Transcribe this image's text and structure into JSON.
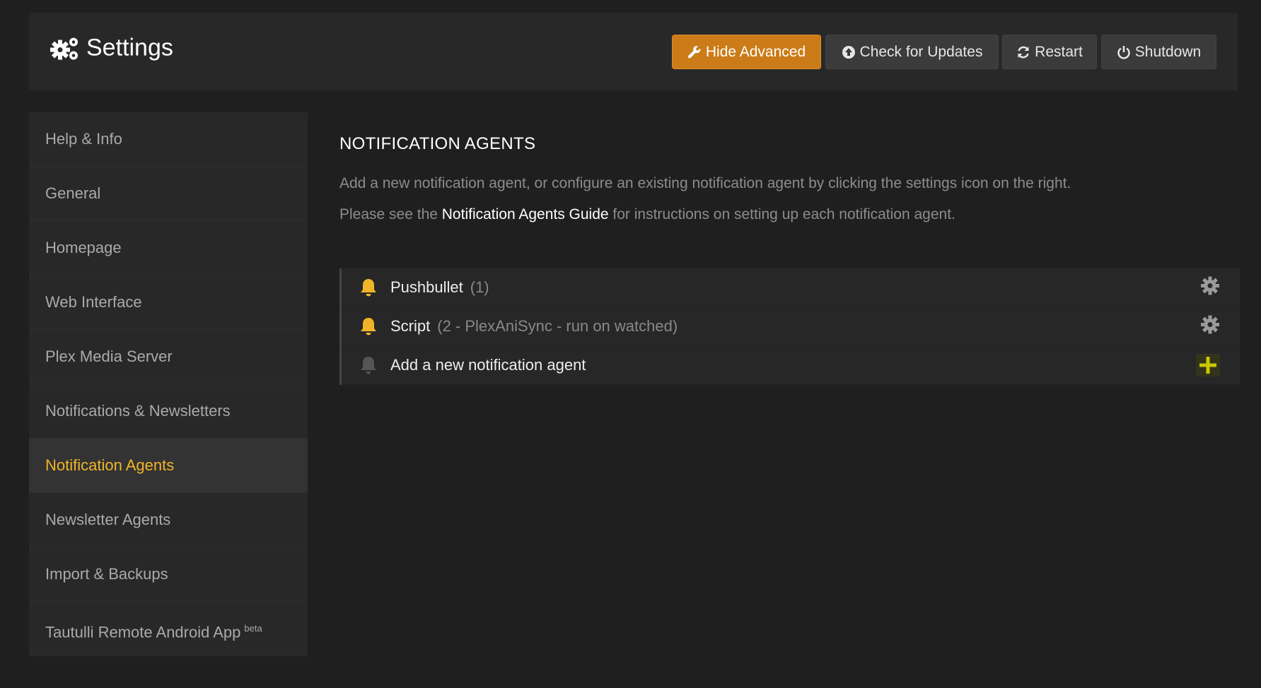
{
  "header": {
    "title": "Settings",
    "buttons": {
      "hide_advanced": "Hide Advanced",
      "check_updates": "Check for Updates",
      "restart": "Restart",
      "shutdown": "Shutdown"
    }
  },
  "sidebar": {
    "items": [
      {
        "label": "Help & Info"
      },
      {
        "label": "General"
      },
      {
        "label": "Homepage"
      },
      {
        "label": "Web Interface"
      },
      {
        "label": "Plex Media Server"
      },
      {
        "label": "Notifications & Newsletters"
      },
      {
        "label": "Notification Agents",
        "active": true
      },
      {
        "label": "Newsletter Agents"
      },
      {
        "label": "Import & Backups"
      },
      {
        "label": "Tautulli Remote Android App",
        "badge": "beta"
      }
    ]
  },
  "main": {
    "title": "NOTIFICATION AGENTS",
    "description_line1": "Add a new notification agent, or configure an existing notification agent by clicking the settings icon on the right.",
    "description_line2_prefix": "Please see the ",
    "guide_link": "Notification Agents Guide",
    "description_line2_suffix": " for instructions on setting up each notification agent.",
    "agents": [
      {
        "name": "Pushbullet",
        "detail": "(1)",
        "icon": "bell-icon",
        "action_icon": "gear-icon"
      },
      {
        "name": "Script",
        "detail": "(2 - PlexAniSync - run on watched)",
        "icon": "bell-icon",
        "action_icon": "gear-icon"
      },
      {
        "name": "Add a new notification agent",
        "detail": "",
        "icon": "bell-icon",
        "action_icon": "plus-icon"
      }
    ]
  },
  "colors": {
    "accent": "#f0b429",
    "advanced_button": "#cc7b19",
    "bell_active": "#f0b429",
    "bell_inactive": "#555555",
    "plus": "#c8c800"
  }
}
